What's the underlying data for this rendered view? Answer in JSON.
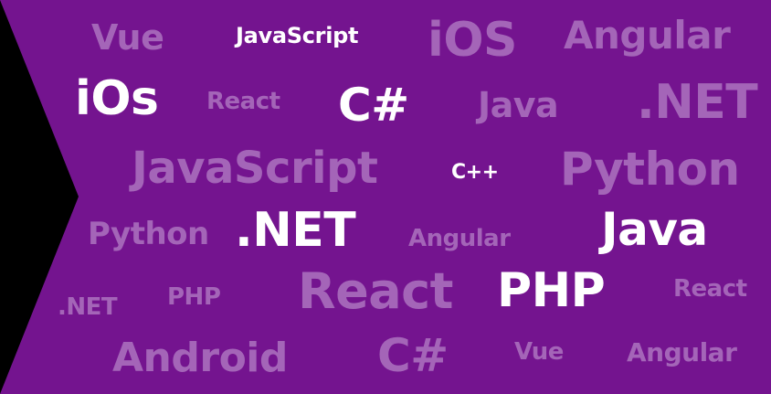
{
  "colors": {
    "background": "#74148f",
    "highlight_text": "#ffffff",
    "faded_text": "#a465b8",
    "edge": "#000000"
  },
  "words": [
    {
      "text": "Vue",
      "style": "faded"
    },
    {
      "text": "JavaScript",
      "style": "highlight"
    },
    {
      "text": "iOS",
      "style": "faded"
    },
    {
      "text": "Angular",
      "style": "faded"
    },
    {
      "text": "iOs",
      "style": "highlight"
    },
    {
      "text": "React",
      "style": "faded"
    },
    {
      "text": "C#",
      "style": "highlight"
    },
    {
      "text": "Java",
      "style": "faded"
    },
    {
      "text": ".NET",
      "style": "faded"
    },
    {
      "text": "JavaScript",
      "style": "faded"
    },
    {
      "text": "C++",
      "style": "highlight"
    },
    {
      "text": "Python",
      "style": "faded"
    },
    {
      "text": "Python",
      "style": "faded"
    },
    {
      "text": ".NET",
      "style": "highlight"
    },
    {
      "text": "Angular",
      "style": "faded"
    },
    {
      "text": "Java",
      "style": "highlight"
    },
    {
      "text": ".NET",
      "style": "faded"
    },
    {
      "text": "PHP",
      "style": "faded"
    },
    {
      "text": "React",
      "style": "faded"
    },
    {
      "text": "PHP",
      "style": "highlight"
    },
    {
      "text": "React",
      "style": "faded"
    },
    {
      "text": "Android",
      "style": "faded"
    },
    {
      "text": "C#",
      "style": "faded"
    },
    {
      "text": "Vue",
      "style": "faded"
    },
    {
      "text": "Angular",
      "style": "faded"
    }
  ]
}
